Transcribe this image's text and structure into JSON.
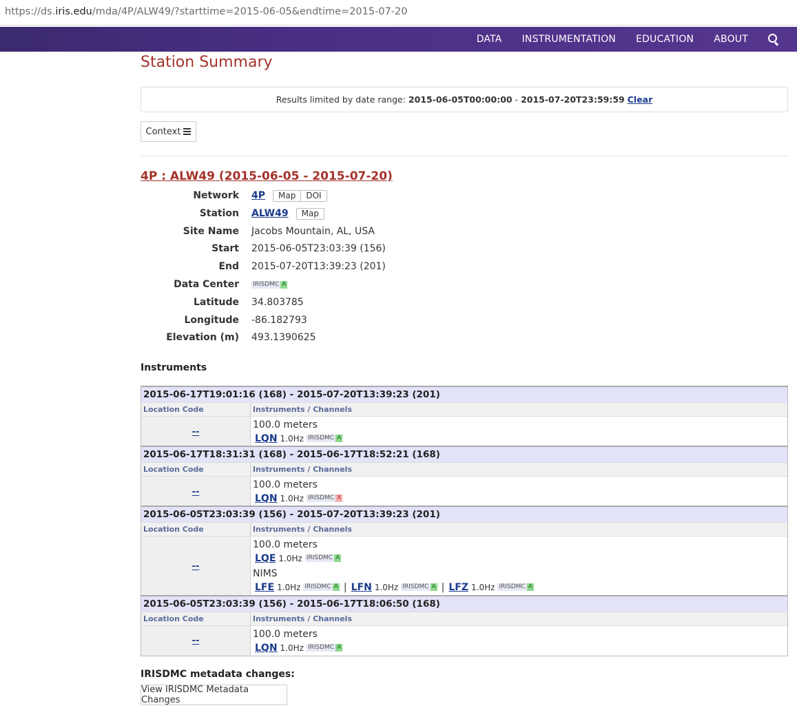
{
  "browser": {
    "url_prefix": "https://ds.",
    "url_domain": "iris.edu",
    "url_rest": "/mda/4P/ALW49/?starttime=2015-06-05&endtime=2015-07-20"
  },
  "nav": {
    "items": [
      "DATA",
      "INSTRUMENTATION",
      "EDUCATION",
      "ABOUT"
    ],
    "search_icon": "search-icon"
  },
  "page": {
    "title": "Station Summary"
  },
  "notice": {
    "text": "Results limited by date range:",
    "range_start": "2015-06-05T00:00:00",
    "range_sep": "-",
    "range_end": "2015-07-20T23:59:59",
    "clear": "Clear"
  },
  "context_button": {
    "label": "Context"
  },
  "station": {
    "title": "4P : ALW49 (2015-06-05 - 2015-07-20)",
    "network_label": "Network",
    "network": "4P",
    "map": "Map",
    "doi": "DOI",
    "station_label": "Station",
    "station": "ALW49",
    "site_label": "Site Name",
    "site": "Jacobs Mountain, AL, USA",
    "start_label": "Start",
    "start": "2015-06-05T23:03:39 (156)",
    "end_label": "End",
    "end": "2015-07-20T13:39:23 (201)",
    "dc_label": "Data Center",
    "dc": "IRISDMC",
    "dc_status": "A",
    "lat_label": "Latitude",
    "lat": "34.803785",
    "lon_label": "Longitude",
    "lon": "-86.182793",
    "elev_label": "Elevation (m)",
    "elev": "493.1390625"
  },
  "instruments": {
    "heading": "Instruments",
    "col_location": "Location Code",
    "col_channels": "Instruments / Channels",
    "epochs": [
      {
        "range": "2015-06-17T19:01:16 (168) - 2015-07-20T13:39:23 (201)",
        "loc": "--",
        "inst1": "100.0 meters",
        "ch1": "LQN",
        "hz1": "1.0Hz",
        "dc1": "IRISDMC",
        "st1": "A"
      },
      {
        "range": "2015-06-17T18:31:31 (168) - 2015-06-17T18:52:21 (168)",
        "loc": "--",
        "inst1": "100.0 meters",
        "ch1": "LQN",
        "hz1": "1.0Hz",
        "dc1": "IRISDMC",
        "st1": "X"
      },
      {
        "range": "2015-06-05T23:03:39 (156) - 2015-07-20T13:39:23 (201)",
        "loc": "--",
        "inst1": "100.0 meters",
        "ch1": "LQE",
        "hz1": "1.0Hz",
        "dc1": "IRISDMC",
        "st1": "A",
        "inst2": "NIMS",
        "ch2": "LFE",
        "hz2": "1.0Hz",
        "dc2": "IRISDMC",
        "st2": "A",
        "sep": "|",
        "ch3": "LFN",
        "hz3": "1.0Hz",
        "dc3": "IRISDMC",
        "st3": "A",
        "ch4": "LFZ",
        "hz4": "1.0Hz",
        "dc4": "IRISDMC",
        "st4": "A"
      },
      {
        "range": "2015-06-05T23:03:39 (156) - 2015-06-17T18:06:50 (168)",
        "loc": "--",
        "inst1": "100.0 meters",
        "ch1": "LQN",
        "hz1": "1.0Hz",
        "dc1": "IRISDMC",
        "st1": "A"
      }
    ]
  },
  "metadata": {
    "heading": "IRISDMC metadata changes:",
    "button": "View IRISDMC Metadata Changes"
  }
}
